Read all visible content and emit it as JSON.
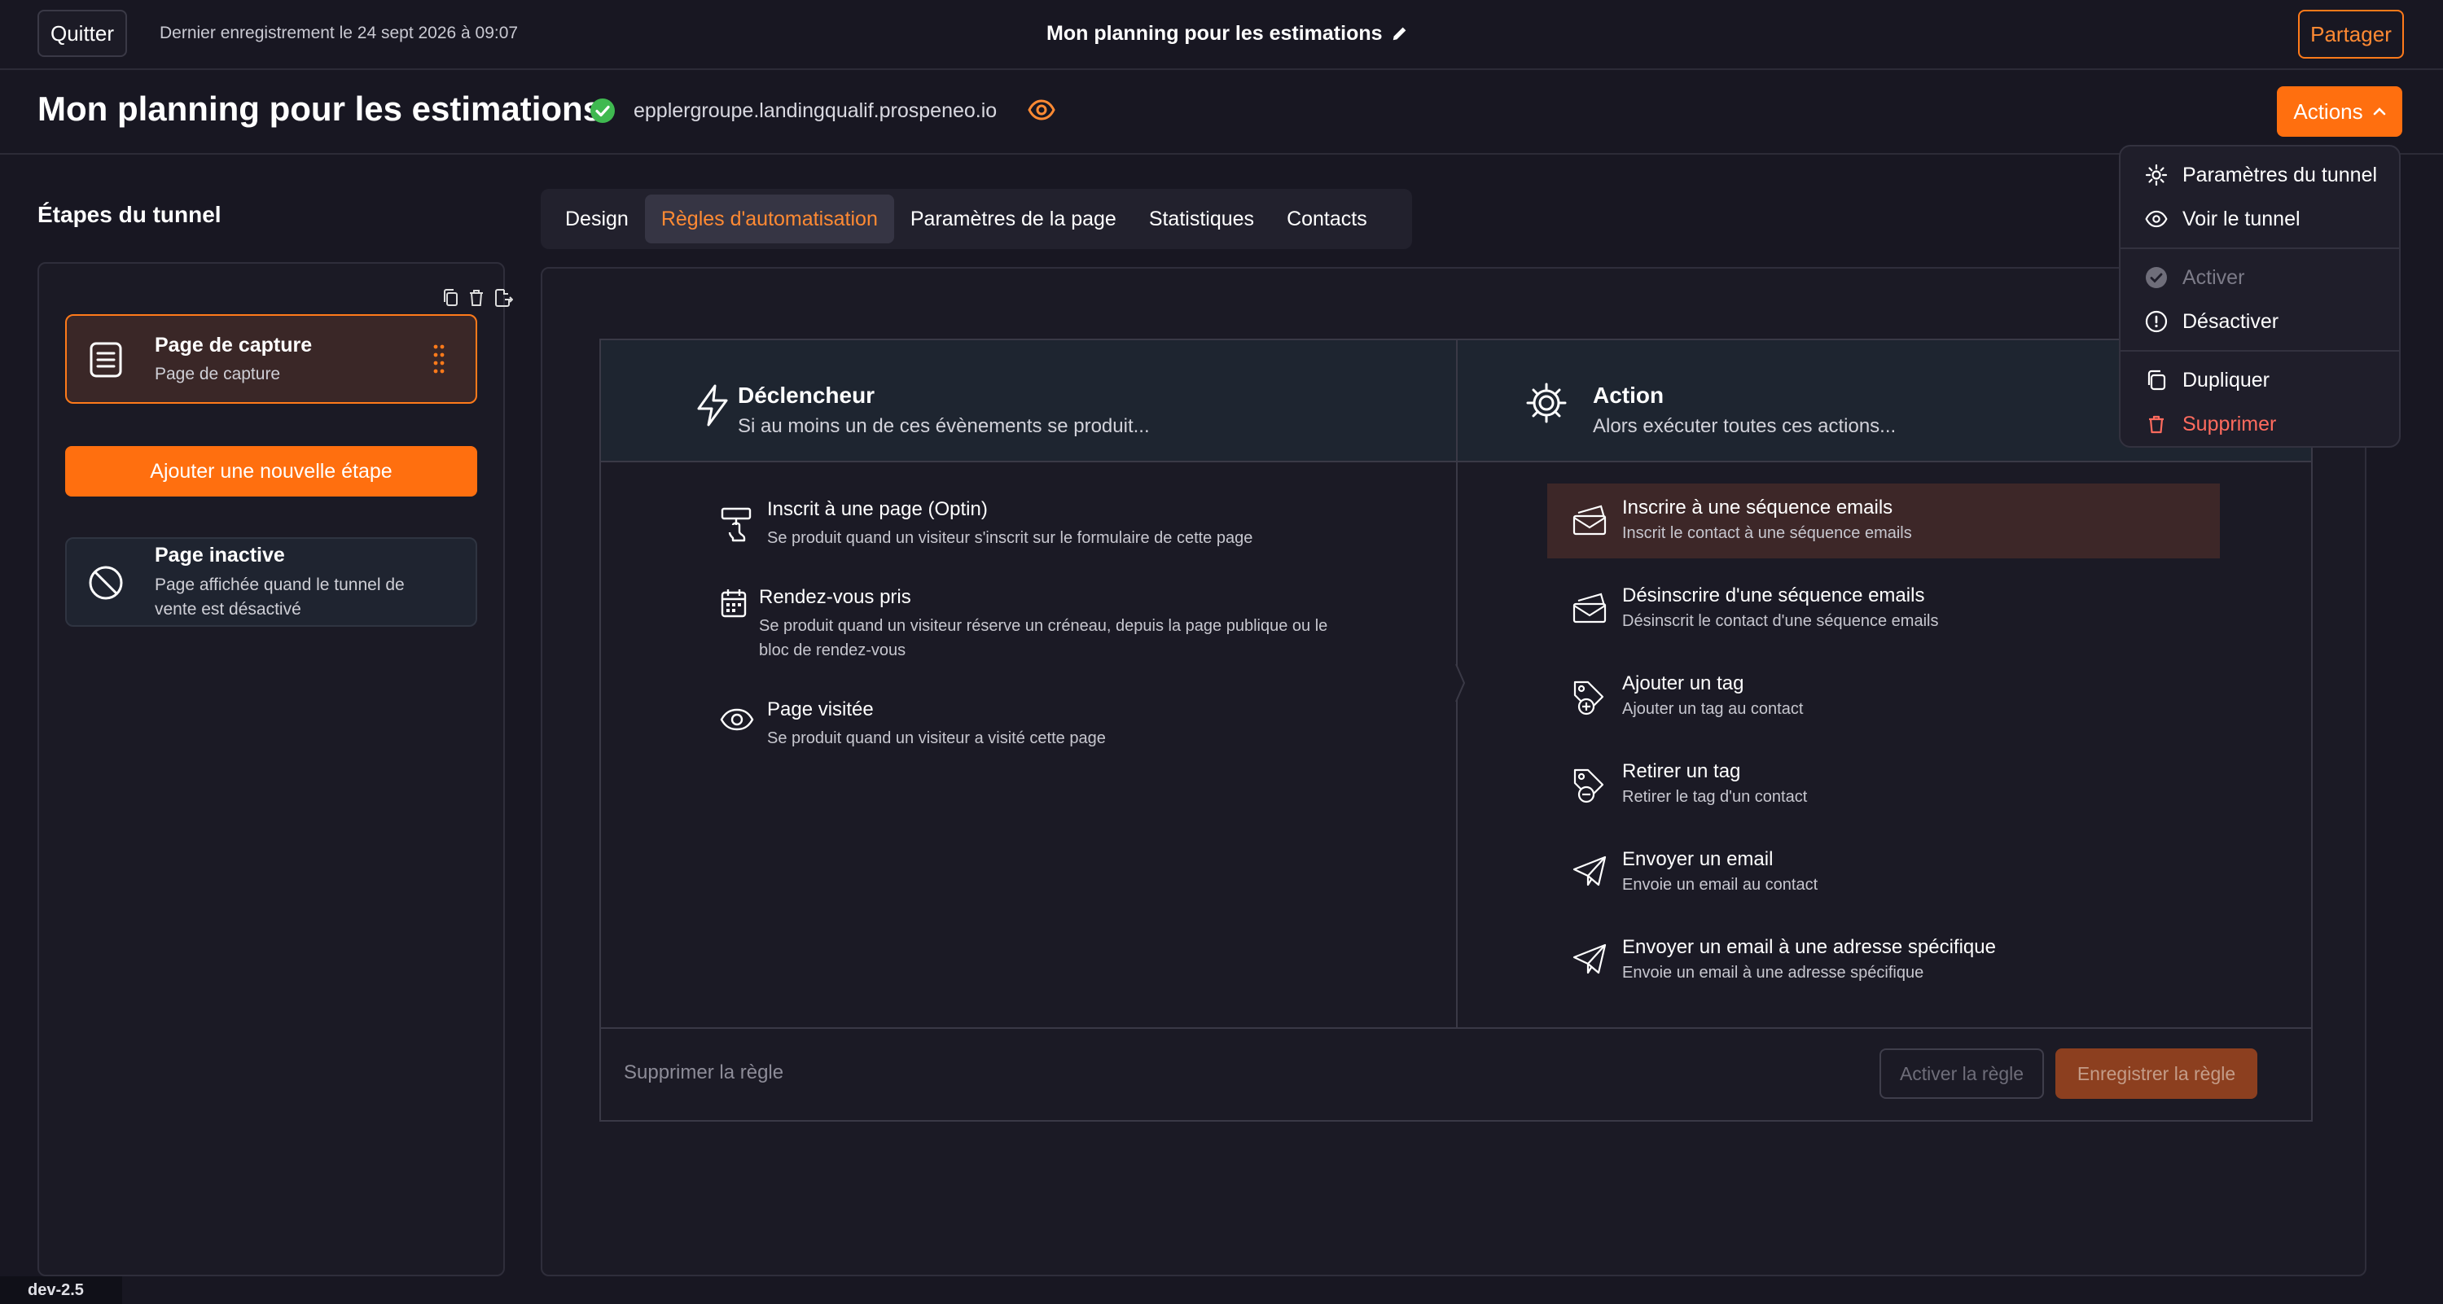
{
  "topbar": {
    "quit_label": "Quitter",
    "last_save": "Dernier enregistrement le 24 sept 2026 à 09:07",
    "title": "Mon planning pour les estimations",
    "share_label": "Partager"
  },
  "header": {
    "title": "Mon planning pour les estimations",
    "domain": "epplergroupe.landingqualif.prospeneo.io",
    "actions_label": "Actions"
  },
  "dropdown": {
    "items": [
      {
        "label": "Paramètres du tunnel",
        "icon": "gear-icon"
      },
      {
        "label": "Voir le tunnel",
        "icon": "eye-icon"
      },
      {
        "label": "Activer",
        "icon": "check-circle-icon",
        "disabled": true
      },
      {
        "label": "Désactiver",
        "icon": "alert-circle-icon"
      },
      {
        "label": "Dupliquer",
        "icon": "copy-icon"
      },
      {
        "label": "Supprimer",
        "icon": "trash-icon",
        "danger": true
      }
    ]
  },
  "sidebar": {
    "title": "Étapes du tunnel",
    "step": {
      "name": "Page de capture",
      "sub": "Page de capture"
    },
    "add_label": "Ajouter une nouvelle étape",
    "inactive": {
      "name": "Page inactive",
      "sub": "Page affichée quand le tunnel de vente est désactivé"
    }
  },
  "tabs": [
    {
      "label": "Design",
      "active": false
    },
    {
      "label": "Règles d'automatisation",
      "active": true
    },
    {
      "label": "Paramètres de la page",
      "active": false
    },
    {
      "label": "Statistiques",
      "active": false
    },
    {
      "label": "Contacts",
      "active": false
    }
  ],
  "rule": {
    "trigger_title": "Déclencheur",
    "trigger_sub": "Si au moins un de ces évènements se produit...",
    "action_title": "Action",
    "action_sub": "Alors exécuter toutes ces actions...",
    "triggers": [
      {
        "title": "Inscrit à une page (Optin)",
        "desc": "Se produit quand un visiteur s'inscrit sur le formulaire de cette page",
        "icon": "optin-icon"
      },
      {
        "title": "Rendez-vous pris",
        "desc": "Se produit quand un visiteur réserve un créneau, depuis la page publique ou le bloc de rendez-vous",
        "icon": "calendar-icon"
      },
      {
        "title": "Page visitée",
        "desc": "Se produit quand un visiteur a visité cette page",
        "icon": "eye-icon"
      }
    ],
    "actions": [
      {
        "title": "Inscrire à une séquence emails",
        "desc": "Inscrit le contact à une séquence emails",
        "icon": "mail-stack-icon",
        "selected": true
      },
      {
        "title": "Désinscrire d'une séquence emails",
        "desc": "Désinscrit le contact d'une séquence emails",
        "icon": "mail-stack-icon"
      },
      {
        "title": "Ajouter un tag",
        "desc": "Ajouter un tag au contact",
        "icon": "tag-add-icon"
      },
      {
        "title": "Retirer un tag",
        "desc": "Retirer le tag d'un contact",
        "icon": "tag-remove-icon"
      },
      {
        "title": "Envoyer un email",
        "desc": "Envoie un email au contact",
        "icon": "send-icon"
      },
      {
        "title": "Envoyer un email à une adresse spécifique",
        "desc": "Envoie un email à une adresse spécifique",
        "icon": "send-icon"
      }
    ],
    "delete_label": "Supprimer la règle",
    "activate_label": "Activer la règle",
    "save_label": "Enregistrer la règle"
  },
  "version": "dev-2.5",
  "colors": {
    "accent": "#ff6f0f",
    "background": "#181722",
    "success": "#3fb950",
    "danger": "#ff6b5e"
  }
}
